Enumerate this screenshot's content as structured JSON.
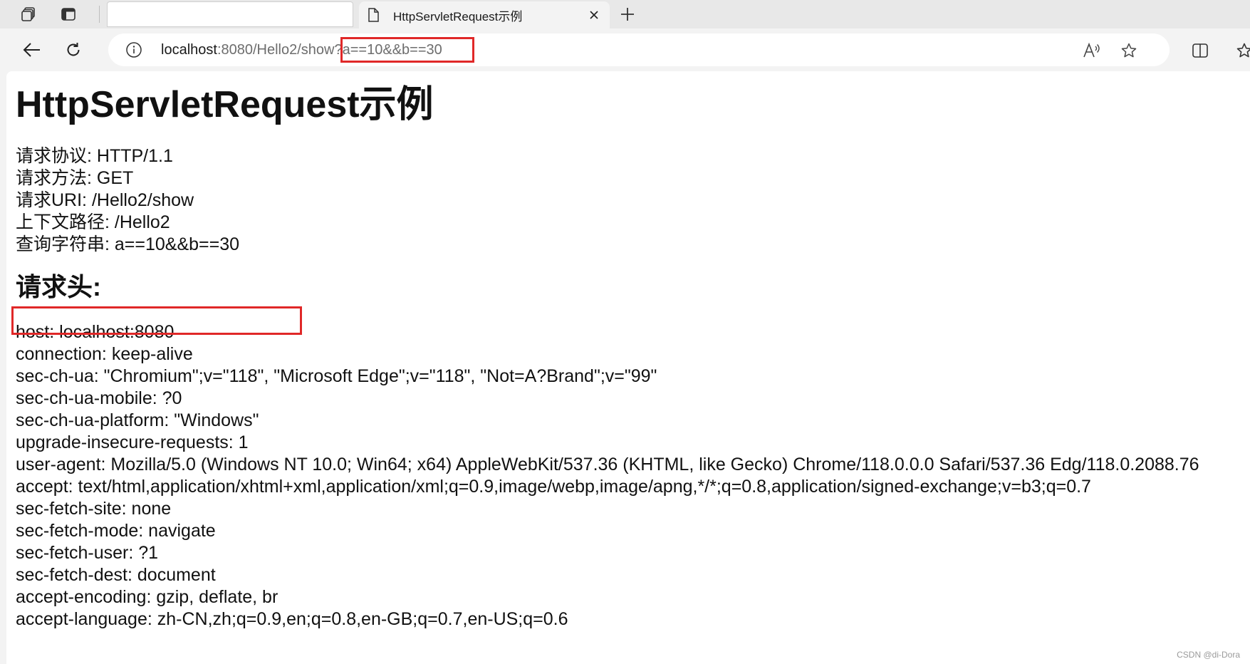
{
  "browser": {
    "tab": {
      "title": "HttpServletRequest示例"
    },
    "address": {
      "host": "localhost",
      "rest": ":8080/Hello2/show",
      "query": "?a==10&&b==30"
    },
    "icons": {
      "workspaces": "workspaces-icon",
      "tab_actions": "tab-actions-icon",
      "page": "page-icon",
      "close": "close-icon",
      "new_tab": "plus-icon",
      "back": "back-arrow-icon",
      "refresh": "refresh-icon",
      "site_info": "info-icon",
      "read_aloud": "read-aloud-icon",
      "favorite": "star-icon",
      "split_screen": "split-screen-icon",
      "favorites_bar": "favorites-icon"
    },
    "colors": {
      "highlight": "#e02828"
    }
  },
  "page": {
    "title": "HttpServletRequest示例",
    "info": [
      "请求协议: HTTP/1.1",
      "请求方法: GET",
      "请求URI: /Hello2/show",
      "上下文路径: /Hello2",
      "查询字符串: a==10&&b==30"
    ],
    "headers_title": "请求头:",
    "headers": [
      "host: localhost:8080",
      "connection: keep-alive",
      "sec-ch-ua: \"Chromium\";v=\"118\", \"Microsoft Edge\";v=\"118\", \"Not=A?Brand\";v=\"99\"",
      "sec-ch-ua-mobile: ?0",
      "sec-ch-ua-platform: \"Windows\"",
      "upgrade-insecure-requests: 1",
      "user-agent: Mozilla/5.0 (Windows NT 10.0; Win64; x64) AppleWebKit/537.36 (KHTML, like Gecko) Chrome/118.0.0.0 Safari/537.36 Edg/118.0.2088.76",
      "accept: text/html,application/xhtml+xml,application/xml;q=0.9,image/webp,image/apng,*/*;q=0.8,application/signed-exchange;v=b3;q=0.7",
      "sec-fetch-site: none",
      "sec-fetch-mode: navigate",
      "sec-fetch-user: ?1",
      "sec-fetch-dest: document",
      "accept-encoding: gzip, deflate, br",
      "accept-language: zh-CN,zh;q=0.9,en;q=0.8,en-GB;q=0.7,en-US;q=0.6"
    ]
  },
  "watermark": "CSDN @di-Dora"
}
